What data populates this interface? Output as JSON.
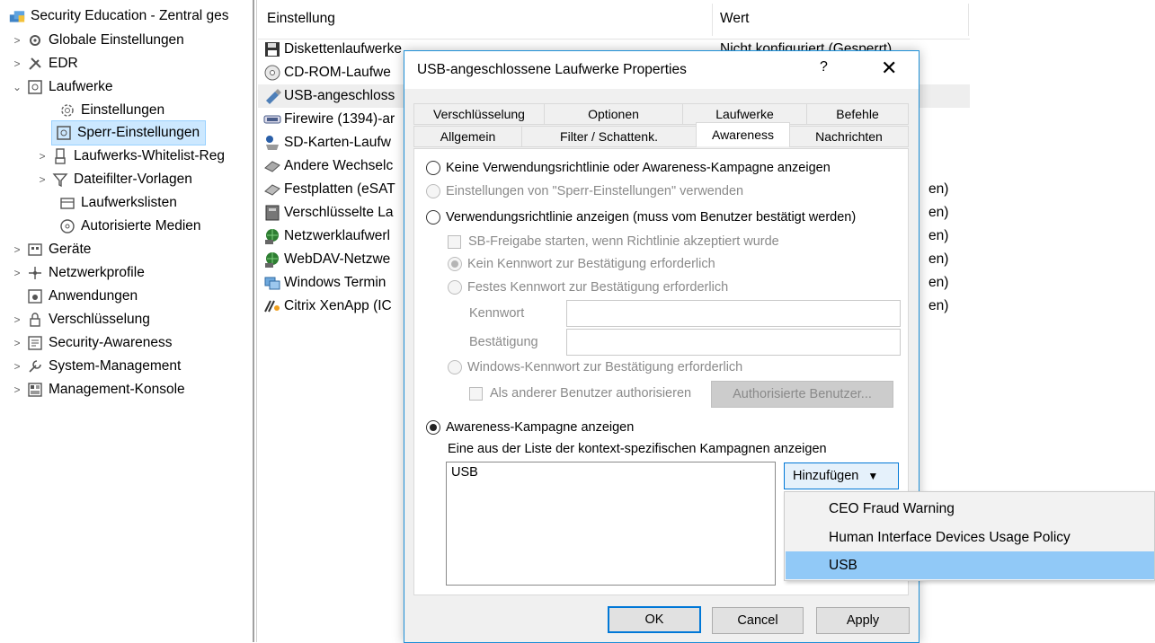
{
  "tree": {
    "root": {
      "label": "Security Education - Zentral ges"
    },
    "items": [
      {
        "label": "Globale Einstellungen",
        "arrow": ">",
        "icon": "gear-network-icon"
      },
      {
        "label": "EDR",
        "arrow": ">",
        "icon": "tools-icon"
      },
      {
        "label": "Laufwerke",
        "arrow": "v",
        "icon": "drive-icon"
      },
      {
        "label": "Einstellungen",
        "icon": "gear-icon"
      },
      {
        "label": "Sperr-Einstellungen",
        "icon": "drive-lock-icon",
        "selected": true
      },
      {
        "label": "Laufwerks-Whitelist-Reg",
        "arrow": ">",
        "icon": "usb-icon"
      },
      {
        "label": "Dateifilter-Vorlagen",
        "arrow": ">",
        "icon": "filter-icon"
      },
      {
        "label": "Laufwerkslisten",
        "icon": "list-icon"
      },
      {
        "label": "Autorisierte Medien",
        "icon": "disc-icon"
      },
      {
        "label": "Geräte",
        "arrow": ">",
        "icon": "devices-icon"
      },
      {
        "label": "Netzwerkprofile",
        "arrow": ">",
        "icon": "network-icon"
      },
      {
        "label": "Anwendungen",
        "icon": "app-icon"
      },
      {
        "label": "Verschlüsselung",
        "arrow": ">",
        "icon": "lock-icon"
      },
      {
        "label": "Security-Awareness",
        "arrow": ">",
        "icon": "awareness-icon"
      },
      {
        "label": "System-Management",
        "arrow": ">",
        "icon": "wrench-icon"
      },
      {
        "label": "Management-Konsole",
        "arrow": ">",
        "icon": "console-icon"
      }
    ]
  },
  "list": {
    "columns": [
      "Einstellung",
      "Wert"
    ],
    "rows": [
      {
        "name": "Diskettenlaufwerke",
        "value": "Nicht konfiguriert (Gesperrt)",
        "icon": "floppy-icon"
      },
      {
        "name": "CD-ROM-Laufwe",
        "value": "",
        "icon": "cdrom-icon"
      },
      {
        "name": "USB-angeschloss",
        "value": "",
        "icon": "usb-drive-icon",
        "highlight": true
      },
      {
        "name": "Firewire (1394)-ar",
        "value": "",
        "icon": "firewire-icon"
      },
      {
        "name": "SD-Karten-Laufw",
        "value": "",
        "icon": "sdcard-icon"
      },
      {
        "name": "Andere Wechselc",
        "value": "",
        "icon": "removable-icon"
      },
      {
        "name": "Festplatten (eSAT",
        "value": "en)",
        "icon": "harddisk-icon"
      },
      {
        "name": "Verschlüsselte La",
        "value": "en)",
        "icon": "encrypted-drive-icon"
      },
      {
        "name": "Netzwerklaufwerl",
        "value": "en)",
        "icon": "network-drive-icon"
      },
      {
        "name": "WebDAV-Netzwe",
        "value": "en)",
        "icon": "webdav-icon"
      },
      {
        "name": "Windows Termin",
        "value": "en)",
        "icon": "terminal-icon"
      },
      {
        "name": "Citrix XenApp (IC",
        "value": "en)",
        "icon": "citrix-icon"
      }
    ]
  },
  "dialog": {
    "title": "USB-angeschlossene Laufwerke Properties",
    "help": "?",
    "close": "✕",
    "tabs_row1": [
      "Verschlüsselung",
      "Optionen",
      "Laufwerke",
      "Befehle"
    ],
    "tabs_row2": [
      "Allgemein",
      "Filter / Schattenk.",
      "Awareness",
      "Nachrichten"
    ],
    "active_tab": "Awareness",
    "options": {
      "no_policy": "Keine Verwendungsrichtlinie oder Awareness-Kampagne anzeigen",
      "use_lock_settings": "Einstellungen von \"Sperr-Einstellungen\" verwenden",
      "show_policy": "Verwendungsrichtlinie anzeigen (muss vom Benutzer bestätigt werden)",
      "start_sb": "SB-Freigabe starten, wenn Richtlinie akzeptiert wurde",
      "no_password": "Kein Kennwort zur Bestätigung erforderlich",
      "fixed_password": "Festes Kennwort zur Bestätigung erforderlich",
      "password_label": "Kennwort",
      "confirm_label": "Bestätigung",
      "windows_password": "Windows-Kennwort zur Bestätigung erforderlich",
      "other_user": "Als anderer Benutzer authorisieren",
      "authorized_users_btn": "Authorisierte Benutzer...",
      "show_campaign": "Awareness-Kampagne anzeigen",
      "campaign_desc": "Eine aus der Liste der kontext-spezifischen Kampagnen anzeigen"
    },
    "campaigns": [
      "USB"
    ],
    "add_button": "Hinzufügen",
    "buttons": {
      "ok": "OK",
      "cancel": "Cancel",
      "apply": "Apply"
    }
  },
  "dropdown": {
    "items": [
      "CEO Fraud Warning",
      "Human Interface Devices Usage Policy",
      "USB"
    ],
    "hovered": "USB"
  }
}
